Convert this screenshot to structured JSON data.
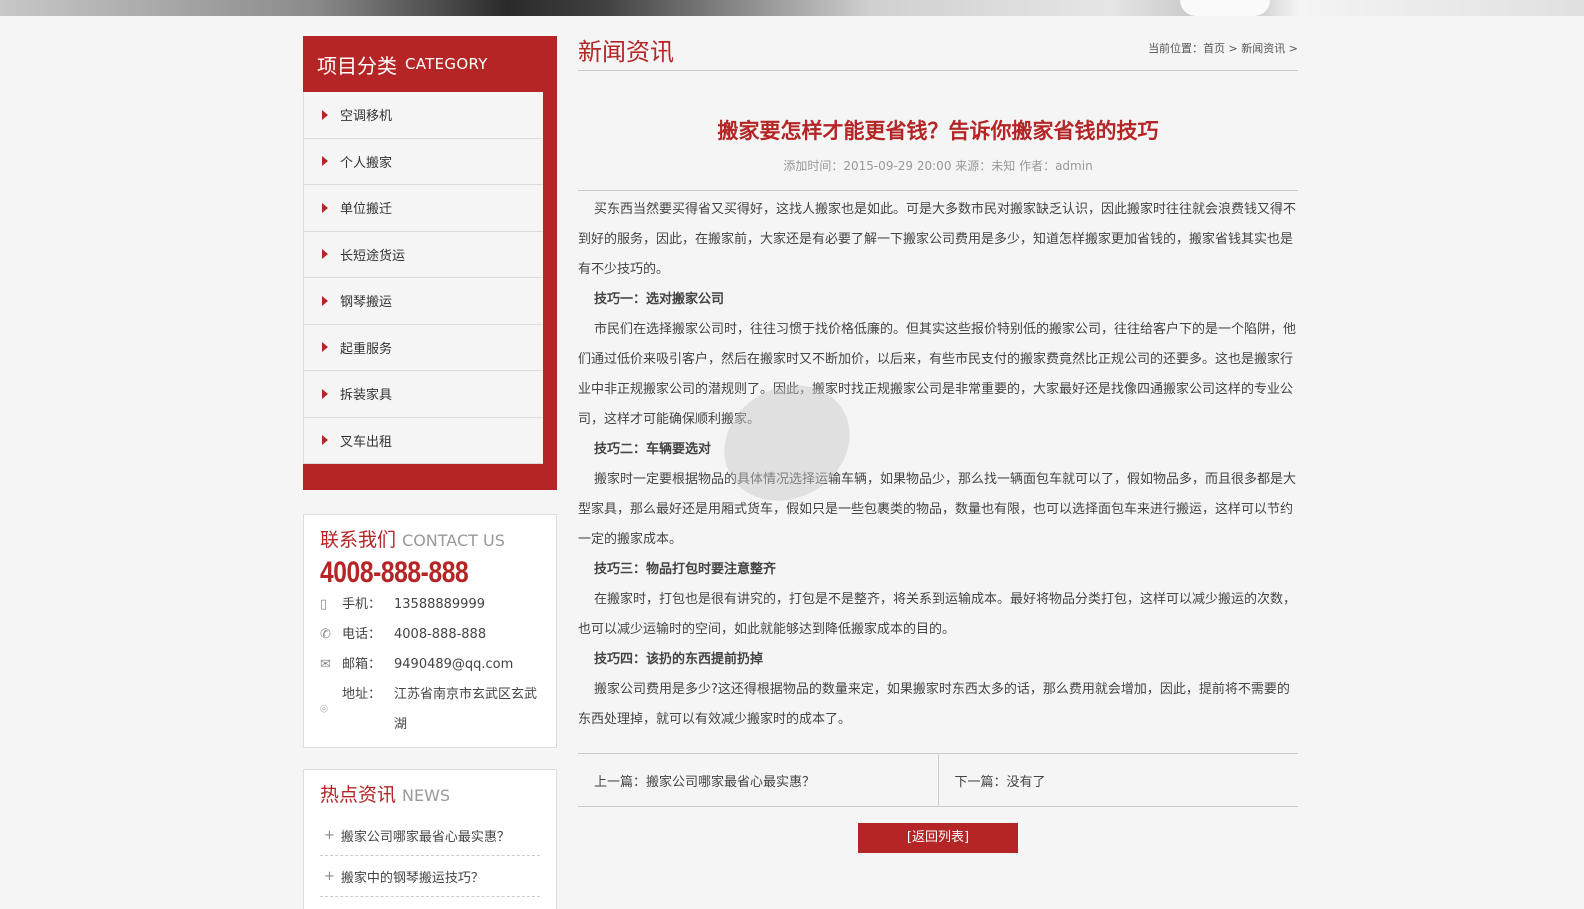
{
  "category": {
    "title_zh": "项目分类",
    "title_en": "CATEGORY",
    "items": [
      "空调移机",
      "个人搬家",
      "单位搬迁",
      "长短途货运",
      "钢琴搬运",
      "起重服务",
      "拆装家具",
      "叉车出租"
    ]
  },
  "contact": {
    "title_zh": "联系我们",
    "title_en": "CONTACT US",
    "hotline": "4008-888-888",
    "mobile_label": "手机：",
    "mobile": "13588889999",
    "phone_label": "电话：",
    "phone": "4008-888-888",
    "email_label": "邮箱：",
    "email": "9490489@qq.com",
    "address_label": "地址：",
    "address": "江苏省南京市玄武区玄武湖"
  },
  "hot_news": {
    "title_zh": "热点资讯",
    "title_en": "NEWS",
    "items": [
      "搬家公司哪家最省心最实惠？",
      "搬家中的钢琴搬运技巧？"
    ]
  },
  "main": {
    "section_title": "新闻资讯",
    "breadcrumb": {
      "prefix": "当前位置：",
      "home": "首页",
      "sep": " > ",
      "current": "新闻资讯",
      "tail": " >"
    },
    "article": {
      "title": "搬家要怎样才能更省钱？告诉你搬家省钱的技巧",
      "meta": "添加时间：2015-09-29 20:00 来源：未知 作者：admin",
      "p1": "买东西当然要买得省又买得好，这找人搬家也是如此。可是大多数市民对搬家缺乏认识，因此搬家时往往就会浪费钱又得不到好的服务，因此，在搬家前，大家还是有必要了解一下搬家公司费用是多少，知道怎样搬家更加省钱的，搬家省钱其实也是有不少技巧的。",
      "h1": "技巧一：选对搬家公司",
      "p2": "市民们在选择搬家公司时，往往习惯于找价格低廉的。但其实这些报价特别低的搬家公司，往往给客户下的是一个陷阱，他们通过低价来吸引客户，然后在搬家时又不断加价，以后来，有些市民支付的搬家费竟然比正规公司的还要多。这也是搬家行业中非正规搬家公司的潜规则了。因此，搬家时找正规搬家公司是非常重要的，大家最好还是找像四通搬家公司这样的专业公司，这样才可能确保顺利搬家。",
      "h2": "技巧二：车辆要选对",
      "p3": "搬家时一定要根据物品的具体情况选择运输车辆，如果物品少，那么找一辆面包车就可以了，假如物品多，而且很多都是大型家具，那么最好还是用厢式货车，假如只是一些包裹类的物品，数量也有限，也可以选择面包车来进行搬运，这样可以节约一定的搬家成本。",
      "h3": "技巧三：物品打包时要注意整齐",
      "p4": "在搬家时，打包也是很有讲究的，打包是不是整齐，将关系到运输成本。最好将物品分类打包，这样可以减少搬运的次数，也可以减少运输时的空间，如此就能够达到降低搬家成本的目的。",
      "h4": "技巧四：该扔的东西提前扔掉",
      "p5": "搬家公司费用是多少?这还得根据物品的数量来定，如果搬家时东西太多的话，那么费用就会增加，因此，提前将不需要的东西处理掉，就可以有效减少搬家时的成本了。"
    },
    "prev": "上一篇：搬家公司哪家最省心最实惠？",
    "next": "下一篇：没有了",
    "back": "[返回列表]"
  },
  "colors": {
    "accent": "#b52525"
  }
}
